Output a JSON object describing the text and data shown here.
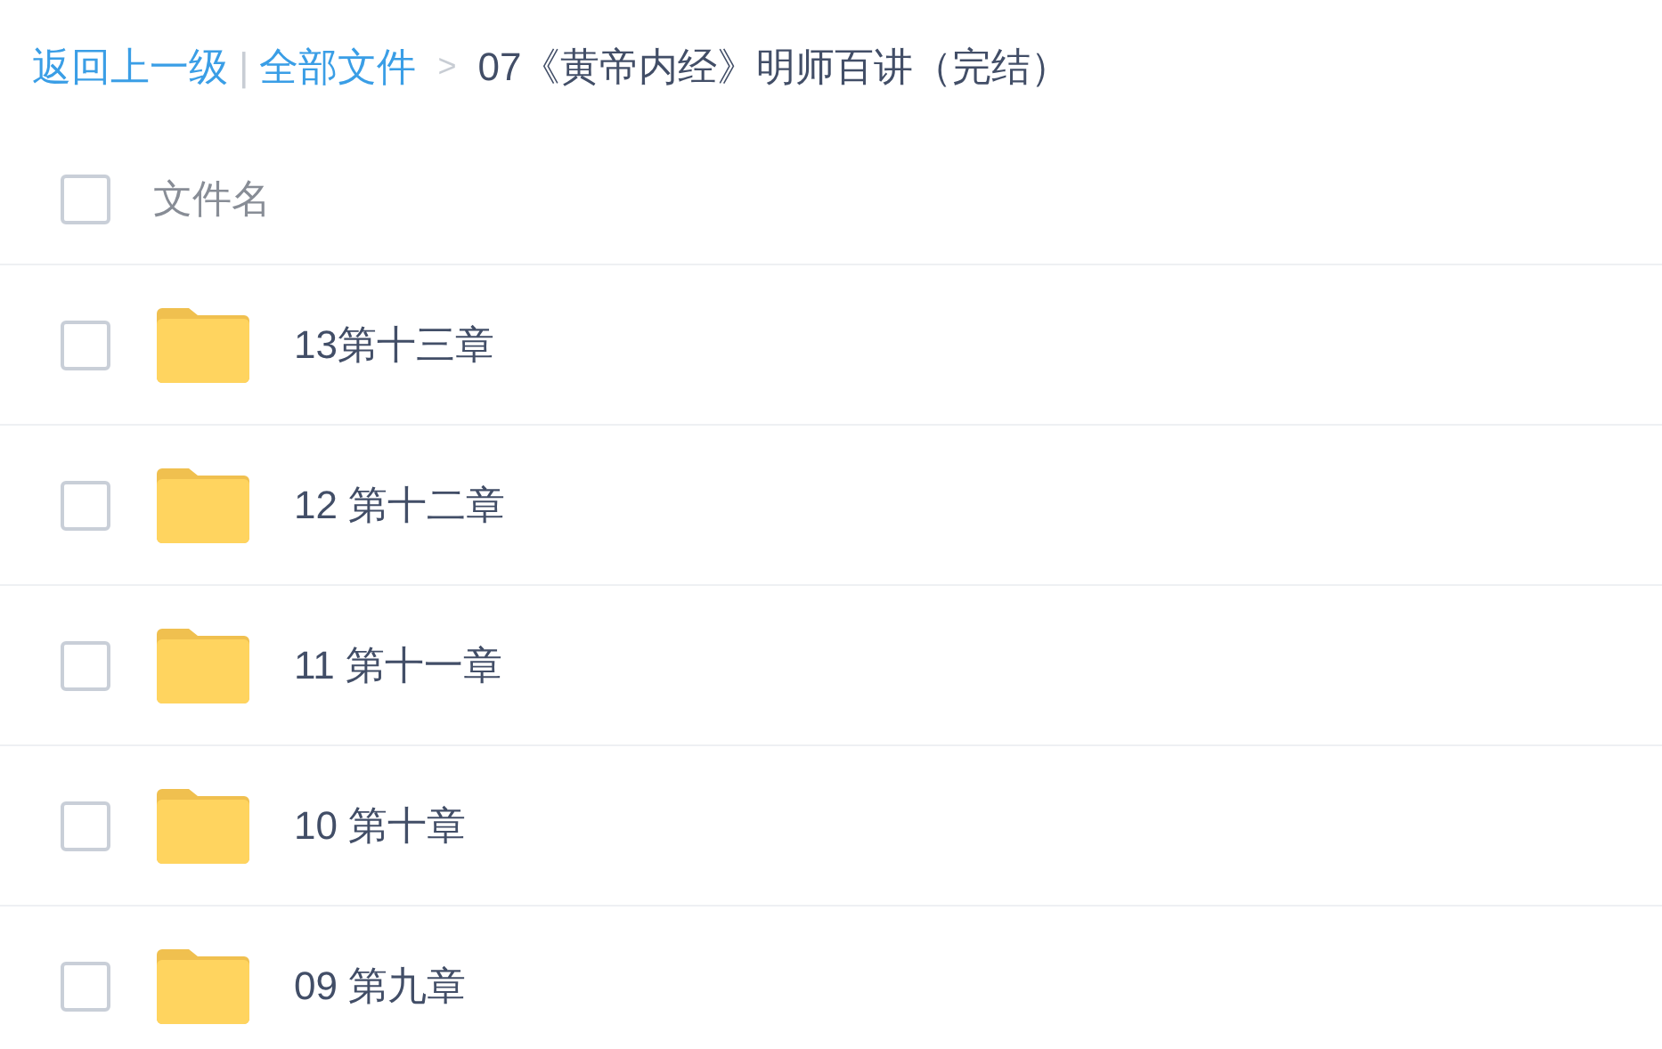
{
  "breadcrumb": {
    "back": "返回上一级",
    "separator": "|",
    "root": "全部文件",
    "arrow": ">",
    "current": "07《黄帝内经》明师百讲（完结）"
  },
  "header": {
    "select_all": {
      "checked": false
    },
    "column": "文件名"
  },
  "rows": [
    {
      "name": "13第十三章",
      "checked": false
    },
    {
      "name": "12 第十二章",
      "checked": false
    },
    {
      "name": "11 第十一章",
      "checked": false
    },
    {
      "name": "10 第十章",
      "checked": false
    },
    {
      "name": "09 第九章",
      "checked": false
    }
  ]
}
